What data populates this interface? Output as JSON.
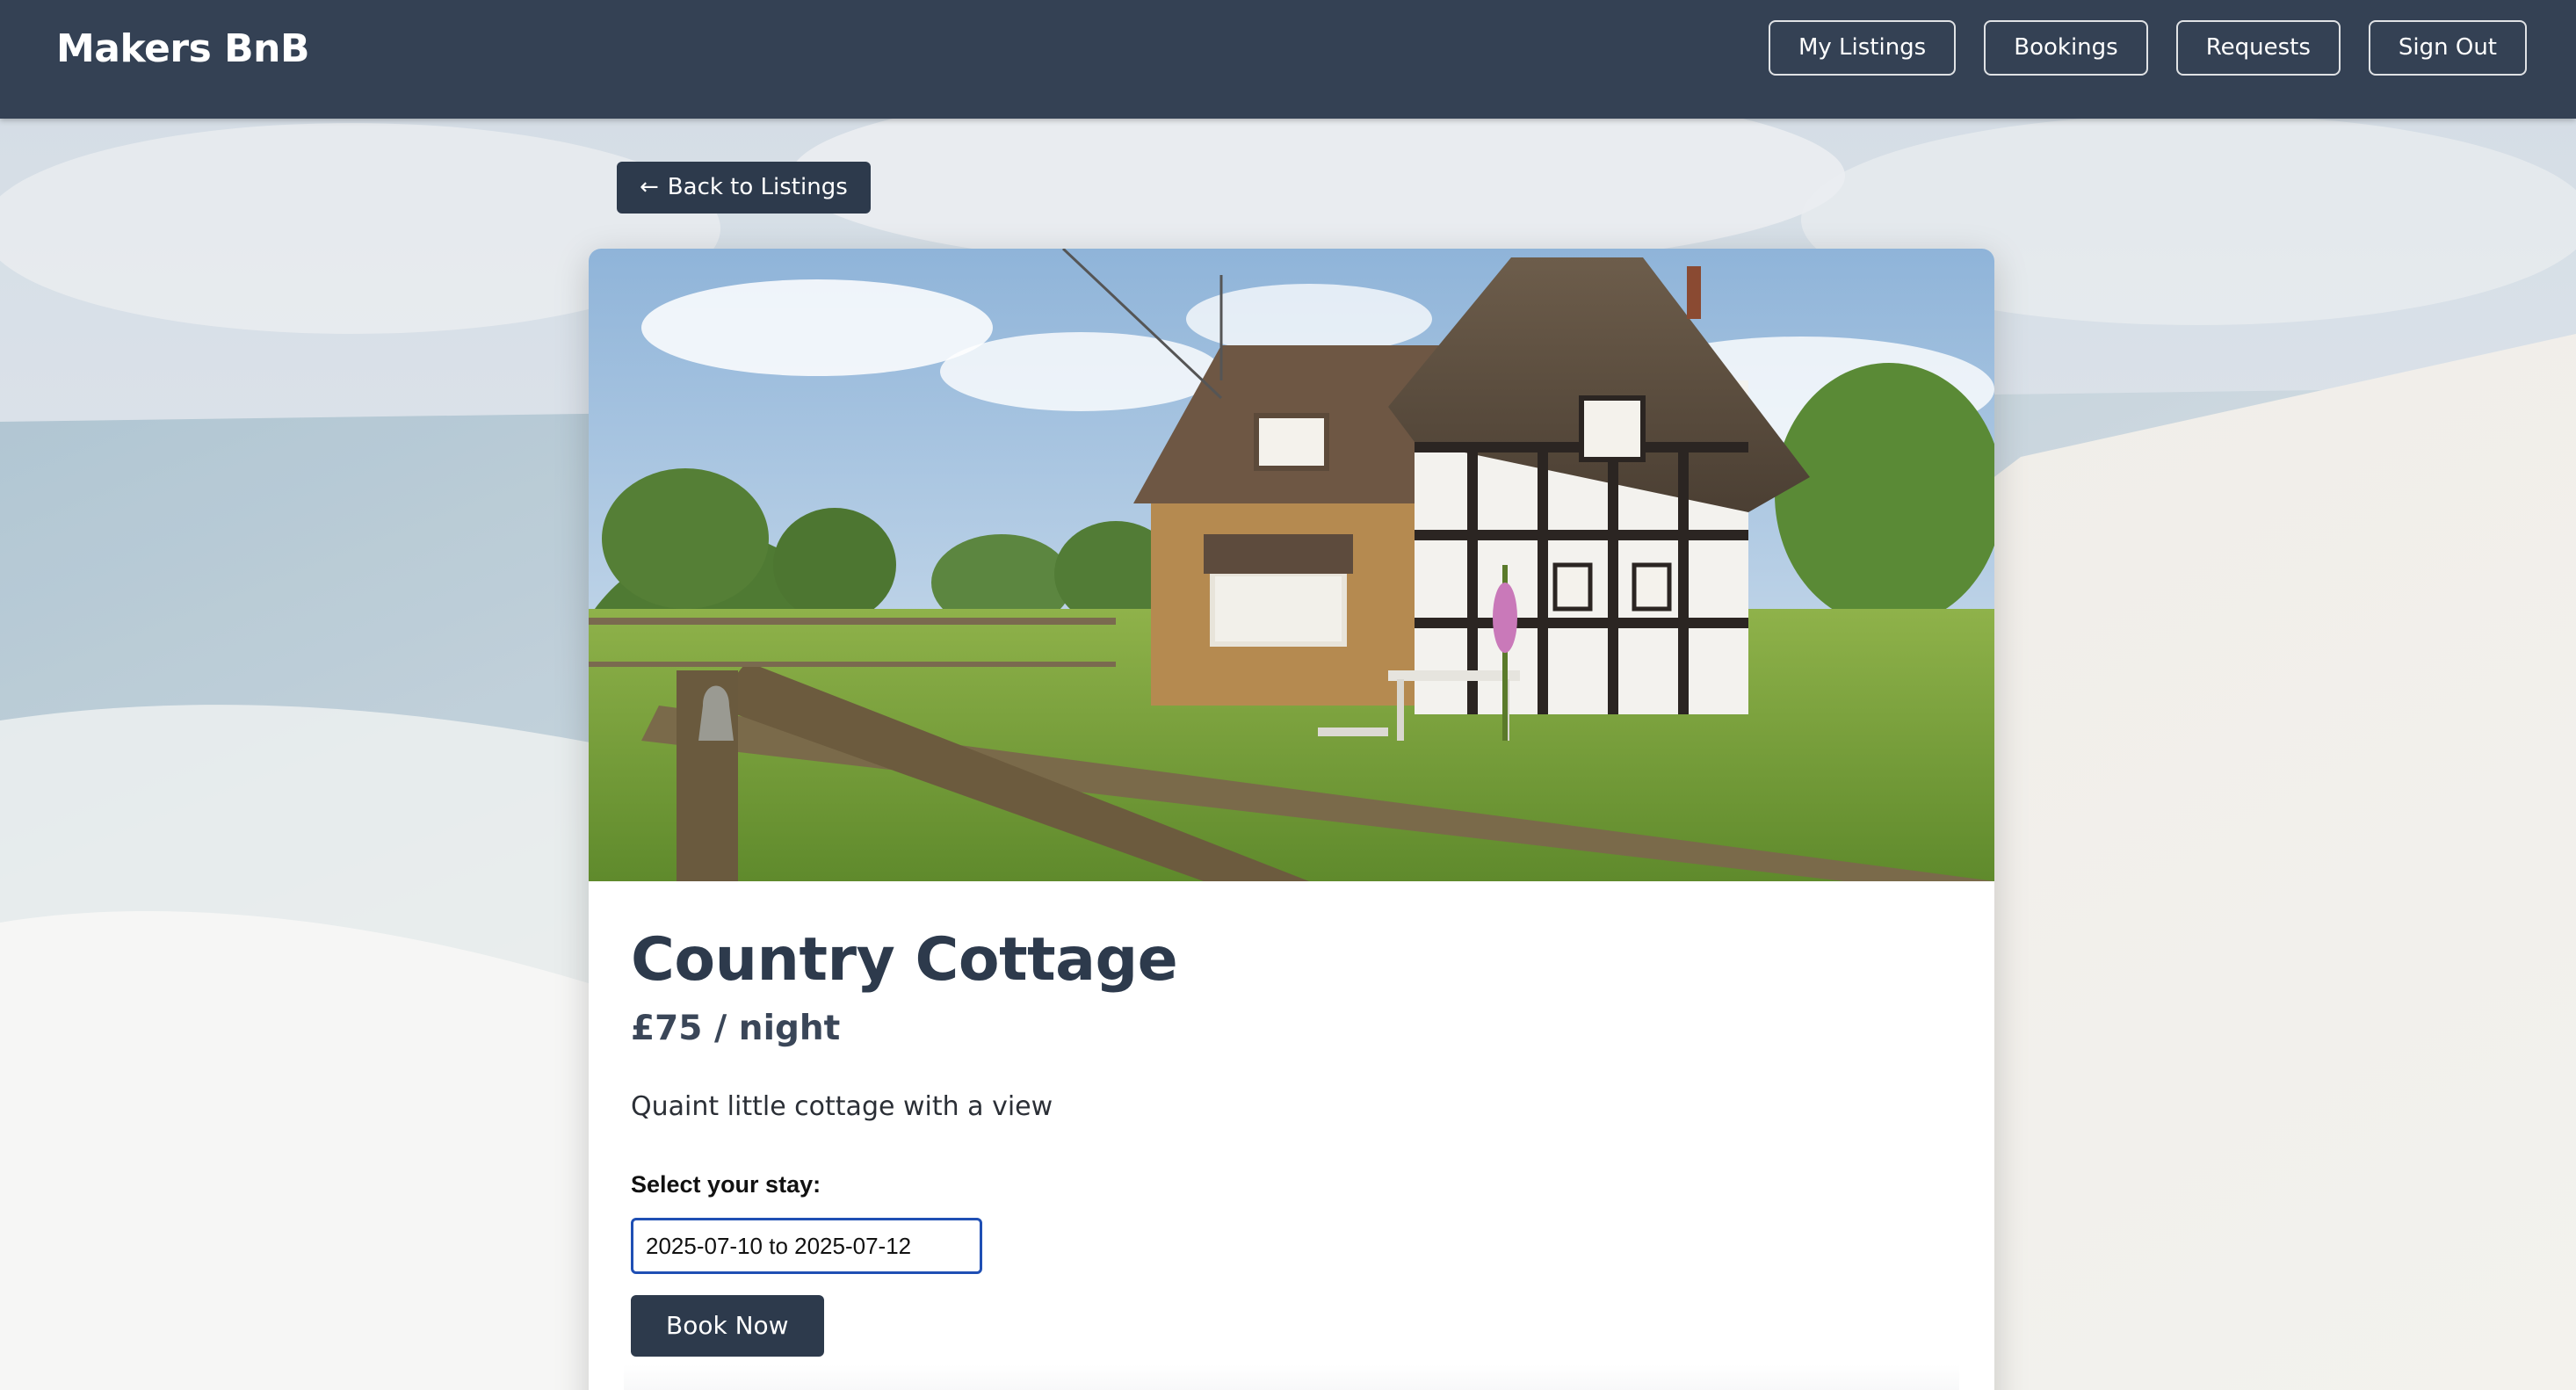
{
  "navbar": {
    "brand": "Makers BnB",
    "buttons": [
      {
        "label": "My Listings"
      },
      {
        "label": "Bookings"
      },
      {
        "label": "Requests"
      },
      {
        "label": "Sign Out"
      }
    ]
  },
  "back_button": {
    "arrow": "←",
    "label": "Back to Listings"
  },
  "listing": {
    "title": "Country Cottage",
    "price": "£75 / night",
    "description": "Quaint little cottage with a view",
    "stay_label": "Select your stay:",
    "date_range_value": "2025-07-10 to 2025-07-12",
    "book_label": "Book Now"
  },
  "colors": {
    "nav_bg": "#344154",
    "primary_button": "#2d3a4c",
    "title_text": "#2d3a4c",
    "input_focus_border": "#1f4fb4"
  }
}
